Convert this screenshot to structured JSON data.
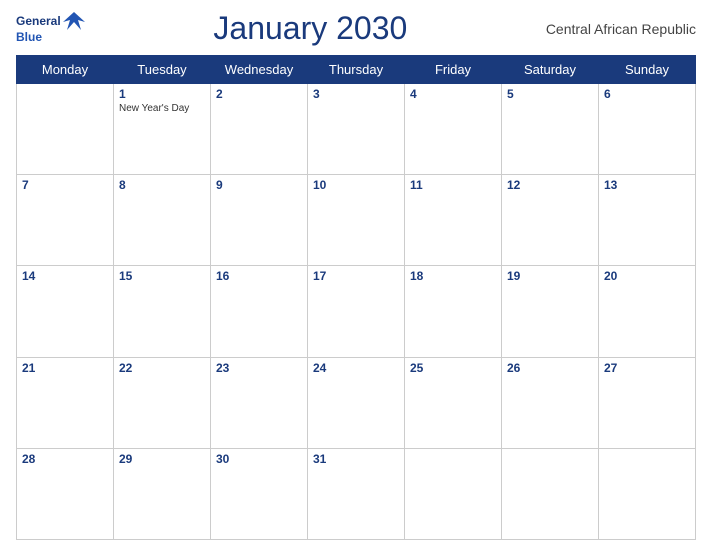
{
  "header": {
    "logo": {
      "general": "General",
      "blue": "Blue",
      "bird_unicode": "▲"
    },
    "title": "January 2030",
    "region": "Central African Republic"
  },
  "days_of_week": [
    "Monday",
    "Tuesday",
    "Wednesday",
    "Thursday",
    "Friday",
    "Saturday",
    "Sunday"
  ],
  "weeks": [
    [
      {
        "day": null,
        "holiday": null
      },
      {
        "day": 1,
        "holiday": "New Year's Day"
      },
      {
        "day": 2,
        "holiday": null
      },
      {
        "day": 3,
        "holiday": null
      },
      {
        "day": 4,
        "holiday": null
      },
      {
        "day": 5,
        "holiday": null
      },
      {
        "day": 6,
        "holiday": null
      }
    ],
    [
      {
        "day": 7,
        "holiday": null
      },
      {
        "day": 8,
        "holiday": null
      },
      {
        "day": 9,
        "holiday": null
      },
      {
        "day": 10,
        "holiday": null
      },
      {
        "day": 11,
        "holiday": null
      },
      {
        "day": 12,
        "holiday": null
      },
      {
        "day": 13,
        "holiday": null
      }
    ],
    [
      {
        "day": 14,
        "holiday": null
      },
      {
        "day": 15,
        "holiday": null
      },
      {
        "day": 16,
        "holiday": null
      },
      {
        "day": 17,
        "holiday": null
      },
      {
        "day": 18,
        "holiday": null
      },
      {
        "day": 19,
        "holiday": null
      },
      {
        "day": 20,
        "holiday": null
      }
    ],
    [
      {
        "day": 21,
        "holiday": null
      },
      {
        "day": 22,
        "holiday": null
      },
      {
        "day": 23,
        "holiday": null
      },
      {
        "day": 24,
        "holiday": null
      },
      {
        "day": 25,
        "holiday": null
      },
      {
        "day": 26,
        "holiday": null
      },
      {
        "day": 27,
        "holiday": null
      }
    ],
    [
      {
        "day": 28,
        "holiday": null
      },
      {
        "day": 29,
        "holiday": null
      },
      {
        "day": 30,
        "holiday": null
      },
      {
        "day": 31,
        "holiday": null
      },
      {
        "day": null,
        "holiday": null
      },
      {
        "day": null,
        "holiday": null
      },
      {
        "day": null,
        "holiday": null
      }
    ]
  ]
}
